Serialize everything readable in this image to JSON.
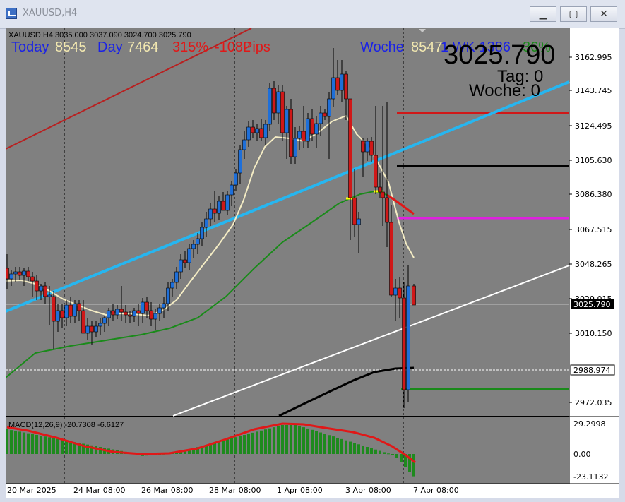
{
  "window": {
    "title": "XAUUSD,H4",
    "minimize_glyph": "▁",
    "maximize_glyph": "▢",
    "close_glyph": "✕"
  },
  "chart": {
    "header": "XAUUSD,H4  3035.000 3037.090 3024.700 3025.790",
    "today_label": "Today",
    "today_value": "8545",
    "day_label": "Day",
    "day_value": "7464",
    "day_pct": "315%",
    "day_pts": "-1082",
    "day_pts2": "Pips",
    "woche_label": "Woche",
    "woche_value": "8547",
    "woche_suffix": "1 WK 1386",
    "woche_pct": "36%",
    "big_price": "3025.790",
    "tag_line": "Tag:  0",
    "woche_line": "Woche:  0",
    "current_price_tag": "3025.790",
    "level_tag": "2988.974",
    "price_ticks": [
      "3162.995",
      "3143.745",
      "3124.495",
      "3105.630",
      "3086.380",
      "3067.515",
      "3048.265",
      "3029.015",
      "3010.150",
      "2972.035"
    ],
    "macd_label": "MACD(12,26,9) -20.7308 -6.6127",
    "macd_ticks": [
      "29.2998",
      "0.00",
      "-23.1132"
    ],
    "date_ticks": [
      "20 Mar 2025",
      "24 Mar 08:00",
      "26 Mar 08:00",
      "28 Mar 08:00",
      "1 Apr 08:00",
      "3 Apr 08:00",
      "7 Apr 08:00"
    ]
  },
  "colors": {
    "background": "#808080",
    "bull": "#1e6fd9",
    "bear": "#d01818",
    "ma_fast": "#f4ecc4",
    "ma_mid": "#1a8a1a",
    "ma_slow": "#000000",
    "trend_blue": "#26b6f0",
    "trend_red": "#b82020",
    "white_line": "#ffffff",
    "magenta": "#e020e0",
    "macd_hist": "#1e8a1e",
    "macd_signal": "#e01818"
  }
}
